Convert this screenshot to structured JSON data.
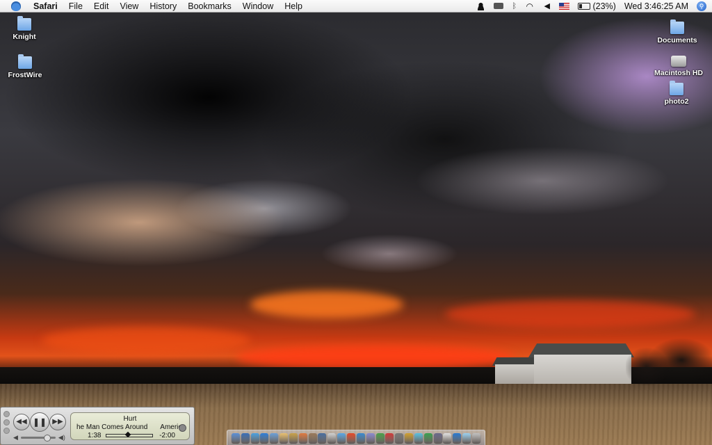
{
  "menubar": {
    "app_name": "Safari",
    "menus": [
      "File",
      "Edit",
      "View",
      "History",
      "Bookmarks",
      "Window",
      "Help"
    ],
    "battery_text": "(23%)",
    "clock": "Wed 3:46:25 AM",
    "status_icons": [
      "user-icon",
      "keyboard-icon",
      "bluetooth-icon",
      "wifi-icon",
      "volume-icon",
      "flag-icon",
      "battery-icon",
      "spotlight-icon"
    ]
  },
  "desktop": {
    "left_items": [
      {
        "label": "Knight",
        "icon": "folder-icon"
      },
      {
        "label": "FrostWire",
        "icon": "folder-icon"
      }
    ],
    "right_items": [
      {
        "label": "Documents",
        "icon": "folder-icon"
      },
      {
        "label": "Macintosh HD",
        "icon": "hard-drive-icon"
      },
      {
        "label": "photo2",
        "icon": "folder-icon"
      }
    ]
  },
  "mini_player": {
    "track": "Hurt",
    "album": "he Man Comes Around",
    "artist": "America",
    "elapsed": "1:38",
    "remaining": "-2:00",
    "progress": 0.45,
    "volume": 0.75
  },
  "dock": {
    "app_colors": [
      "#5a8fd6",
      "#3a6fb8",
      "#4aa0e0",
      "#2f7fd8",
      "#6a9fd8",
      "#e8c070",
      "#c9a24a",
      "#e07a40",
      "#9a7a5a",
      "#4a6fa0",
      "#d0d0d0",
      "#5aa6e6",
      "#e64a2a",
      "#3a8ad0",
      "#8a8ad0",
      "#4aa04a",
      "#d03a3a",
      "#7a7a7a",
      "#d0a030",
      "#5ac0e0",
      "#3aa050",
      "#6a6a8a",
      "#e0e0e0",
      "#2a7ad0",
      "#9ad0f0",
      "#c0c0c0"
    ]
  }
}
